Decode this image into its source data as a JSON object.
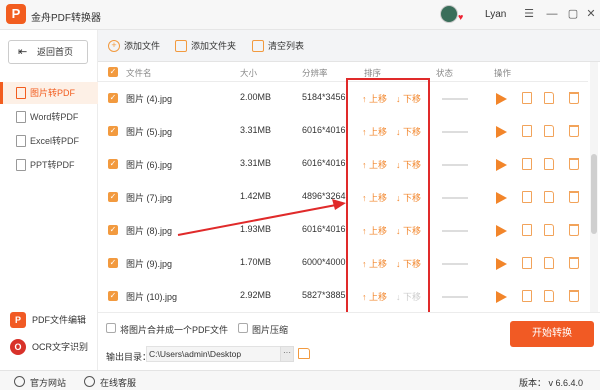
{
  "titlebar": {
    "app_title": "金舟PDF转换器",
    "logo_letter": "P",
    "username": "Lyan",
    "minimize": "—",
    "restore": "▢",
    "close": "✕",
    "menu": "☰"
  },
  "sidebar": {
    "back_label": "返回首页",
    "items": [
      {
        "label": "图片转PDF"
      },
      {
        "label": "Word转PDF"
      },
      {
        "label": "Excel转PDF"
      },
      {
        "label": "PPT转PDF"
      }
    ],
    "bottom_items": [
      {
        "label": "PDF文件编辑",
        "icon_text": "P"
      },
      {
        "label": "OCR文字识别",
        "icon_text": "O"
      }
    ]
  },
  "toolbar": {
    "add_file": "添加文件",
    "add_folder": "添加文件夹",
    "clear_list": "清空列表"
  },
  "table": {
    "headers": {
      "name": "文件名",
      "size": "大小",
      "resolution": "分辨率",
      "order": "排序",
      "status": "状态",
      "actions": "操作"
    },
    "move_up": "上移",
    "move_down": "下移",
    "rows": [
      {
        "name": "图片 (4).jpg",
        "size": "2.00MB",
        "resolution": "5184*3456"
      },
      {
        "name": "图片 (5).jpg",
        "size": "3.31MB",
        "resolution": "6016*4016"
      },
      {
        "name": "图片 (6).jpg",
        "size": "3.31MB",
        "resolution": "6016*4016"
      },
      {
        "name": "图片 (7).jpg",
        "size": "1.42MB",
        "resolution": "4896*3264"
      },
      {
        "name": "图片 (8).jpg",
        "size": "1.93MB",
        "resolution": "6016*4016"
      },
      {
        "name": "图片 (9).jpg",
        "size": "1.70MB",
        "resolution": "6000*4000"
      },
      {
        "name": "图片 (10).jpg",
        "size": "2.92MB",
        "resolution": "5827*3885"
      }
    ]
  },
  "bottom_panel": {
    "merge_label": "将图片合并成一个PDF文件",
    "compress_label": "图片压缩",
    "output_label": "输出目录：",
    "output_path": "C:\\Users\\admin\\Desktop",
    "more": "···",
    "start_button": "开始转换"
  },
  "footer": {
    "website": "官方网站",
    "support": "在线客服",
    "version": "版本： v 6.6.4.0"
  },
  "colors": {
    "accent": "#f15a24",
    "highlight_border": "#e02a2a"
  }
}
